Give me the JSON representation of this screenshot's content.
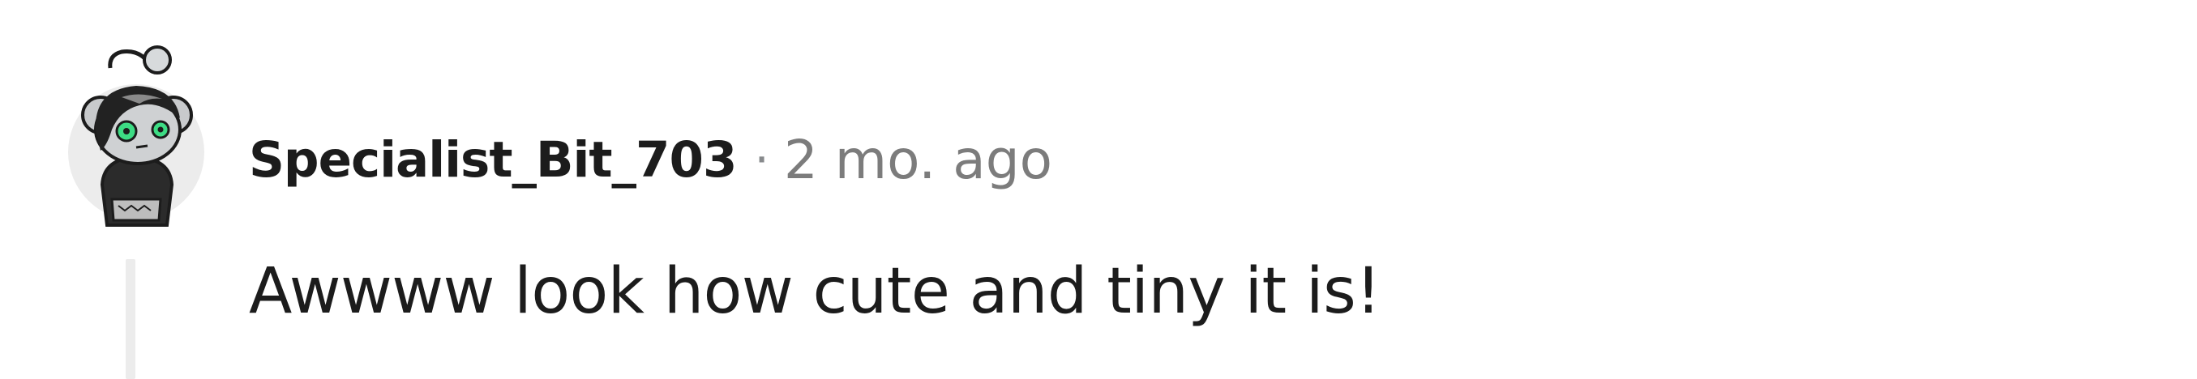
{
  "comment": {
    "avatar_icon": "snoo-avatar-icon",
    "username": "Specialist_Bit_703",
    "separator": "·",
    "timestamp": "2 mo. ago",
    "body": "Awwww look how cute and tiny it is!"
  },
  "colors": {
    "username": "#1c1c1c",
    "timestamp": "#7c7c7c",
    "thread_line": "#ececec",
    "avatar_bg": "#ececec",
    "avatar_eyes": "#3ddc84"
  }
}
